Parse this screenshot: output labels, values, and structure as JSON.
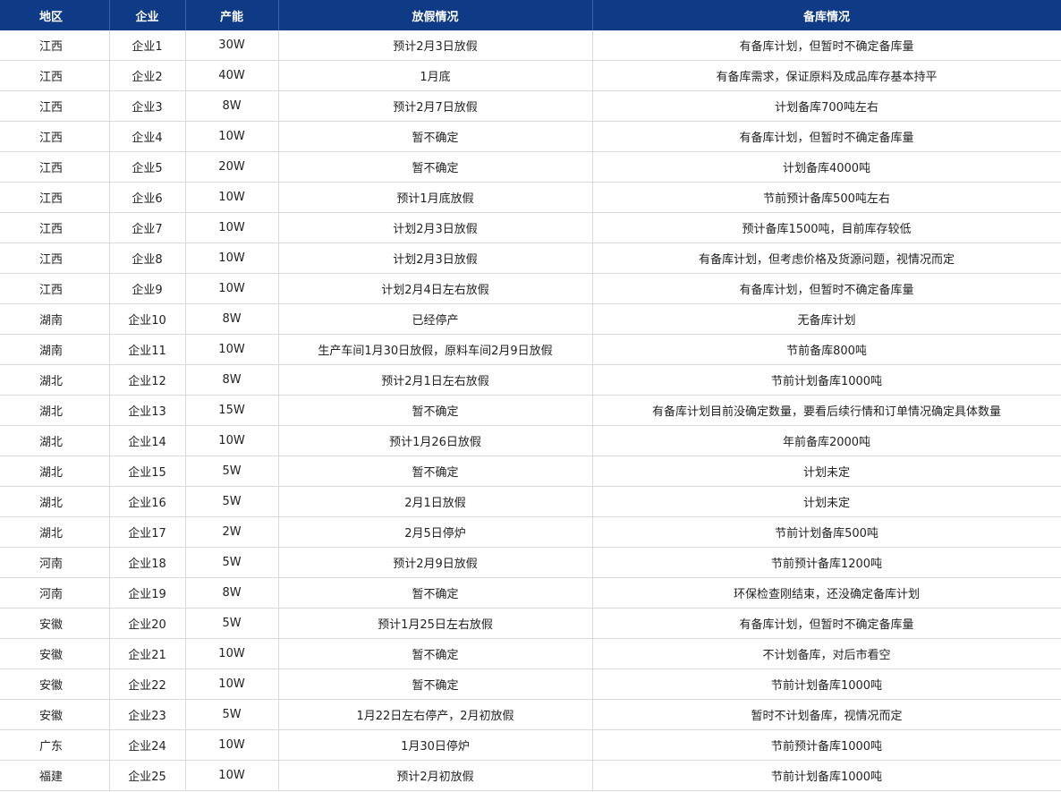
{
  "table": {
    "headers": [
      "地区",
      "企业",
      "产能",
      "放假情况",
      "备库情况"
    ],
    "rows": [
      [
        "江西",
        "企业1",
        "30W",
        "预计2月3日放假",
        "有备库计划，但暂时不确定备库量"
      ],
      [
        "江西",
        "企业2",
        "40W",
        "1月底",
        "有备库需求，保证原料及成品库存基本持平"
      ],
      [
        "江西",
        "企业3",
        "8W",
        "预计2月7日放假",
        "计划备库700吨左右"
      ],
      [
        "江西",
        "企业4",
        "10W",
        "暂不确定",
        "有备库计划，但暂时不确定备库量"
      ],
      [
        "江西",
        "企业5",
        "20W",
        "暂不确定",
        "计划备库4000吨"
      ],
      [
        "江西",
        "企业6",
        "10W",
        "预计1月底放假",
        "节前预计备库500吨左右"
      ],
      [
        "江西",
        "企业7",
        "10W",
        "计划2月3日放假",
        "预计备库1500吨，目前库存较低"
      ],
      [
        "江西",
        "企业8",
        "10W",
        "计划2月3日放假",
        "有备库计划，但考虑价格及货源问题，视情况而定"
      ],
      [
        "江西",
        "企业9",
        "10W",
        "计划2月4日左右放假",
        "有备库计划，但暂时不确定备库量"
      ],
      [
        "湖南",
        "企业10",
        "8W",
        "已经停产",
        "无备库计划"
      ],
      [
        "湖南",
        "企业11",
        "10W",
        "生产车间1月30日放假，原料车间2月9日放假",
        "节前备库800吨"
      ],
      [
        "湖北",
        "企业12",
        "8W",
        "预计2月1日左右放假",
        "节前计划备库1000吨"
      ],
      [
        "湖北",
        "企业13",
        "15W",
        "暂不确定",
        "有备库计划目前没确定数量，要看后续行情和订单情况确定具体数量"
      ],
      [
        "湖北",
        "企业14",
        "10W",
        "预计1月26日放假",
        "年前备库2000吨"
      ],
      [
        "湖北",
        "企业15",
        "5W",
        "暂不确定",
        "计划未定"
      ],
      [
        "湖北",
        "企业16",
        "5W",
        "2月1日放假",
        "计划未定"
      ],
      [
        "湖北",
        "企业17",
        "2W",
        "2月5日停炉",
        "节前计划备库500吨"
      ],
      [
        "河南",
        "企业18",
        "5W",
        "预计2月9日放假",
        "节前预计备库1200吨"
      ],
      [
        "河南",
        "企业19",
        "8W",
        "暂不确定",
        "环保检查刚结束，还没确定备库计划"
      ],
      [
        "安徽",
        "企业20",
        "5W",
        "预计1月25日左右放假",
        "有备库计划，但暂时不确定备库量"
      ],
      [
        "安徽",
        "企业21",
        "10W",
        "暂不确定",
        "不计划备库，对后市看空"
      ],
      [
        "安徽",
        "企业22",
        "10W",
        "暂不确定",
        "节前计划备库1000吨"
      ],
      [
        "安徽",
        "企业23",
        "5W",
        "1月22日左右停产，2月初放假",
        "暂时不计划备库，视情况而定"
      ],
      [
        "广东",
        "企业24",
        "10W",
        "1月30日停炉",
        "节前预计备库1000吨"
      ],
      [
        "福建",
        "企业25",
        "10W",
        "预计2月初放假",
        "节前计划备库1000吨"
      ]
    ]
  }
}
